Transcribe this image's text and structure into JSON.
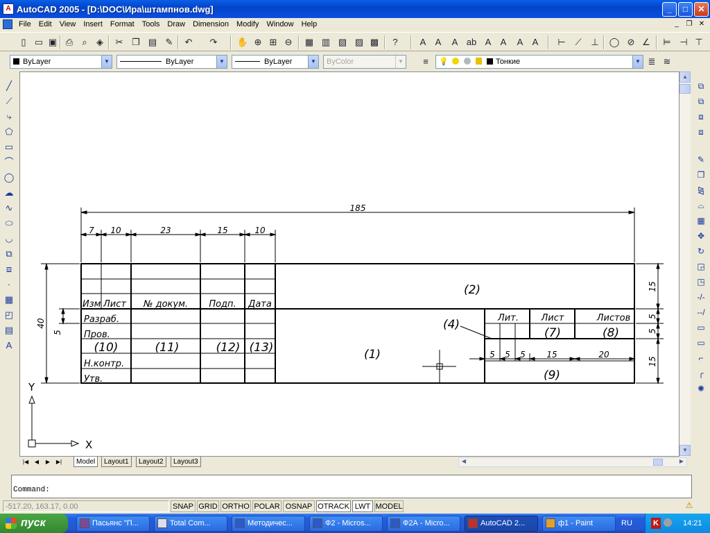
{
  "window": {
    "title": "AutoCAD 2005 - [D:\\DOC\\Ира\\штампнов.dwg]",
    "minimize": "_",
    "maximize": "□",
    "close": "✕"
  },
  "menu": {
    "items": [
      "File",
      "Edit",
      "View",
      "Insert",
      "Format",
      "Tools",
      "Draw",
      "Dimension",
      "Modify",
      "Window",
      "Help"
    ],
    "mdi_min": "_",
    "mdi_restore": "❐",
    "mdi_close": "✕"
  },
  "props": {
    "color": "ByLayer",
    "linetype": "ByLayer",
    "lineweight": "ByLayer",
    "plotstyle": "ByColor",
    "layer": "Тонкие"
  },
  "drawing": {
    "dims": {
      "total": "185",
      "d7": "7",
      "d10": "10",
      "d23": "23",
      "d15": "15",
      "d10b": "10",
      "h40": "40",
      "h5": "5",
      "r15a": "15",
      "r5a": "5",
      "r5b": "5",
      "r15b": "15",
      "s5a": "5",
      "s5b": "5",
      "s5c": "5",
      "s15": "15",
      "s20": "20"
    },
    "headers": {
      "izm": "Изм",
      "list": "Лист",
      "ndoc": "№ докум.",
      "podp": "Подп.",
      "data": "Дата",
      "lit": "Лит.",
      "list2": "Лист",
      "listov": "Листов"
    },
    "rows": {
      "razrab": "Разраб.",
      "prov": "Пров.",
      "nkontr": "Н.контр.",
      "utv": "Утв."
    },
    "fields": {
      "f1": "(1)",
      "f2": "(2)",
      "f4": "(4)",
      "f7": "(7)",
      "f8": "(8)",
      "f9": "(9)",
      "f10": "(10)",
      "f11": "(11)",
      "f12": "(12)",
      "f13": "(13)"
    },
    "ucs": {
      "x": "X",
      "y": "Y"
    }
  },
  "tabs": {
    "model": "Model",
    "layout1": "Layout1",
    "layout2": "Layout2",
    "layout3": "Layout3"
  },
  "command": {
    "prompt": "Command:"
  },
  "status": {
    "coords": "-517.20, 163.17, 0.00",
    "buttons": [
      "SNAP",
      "GRID",
      "ORTHO",
      "POLAR",
      "OSNAP",
      "OTRACK",
      "LWT",
      "MODEL"
    ]
  },
  "taskbar": {
    "start": "пуск",
    "tasks": [
      "Пасьянс \"П...",
      "Total Com...",
      "Методичес...",
      "Ф2 - Micros...",
      "Ф2А - Micro...",
      "AutoCAD 2...",
      "ф1 - Paint"
    ],
    "lang": "RU",
    "clock": "14:21"
  },
  "colors": {
    "title_bar": "#0a4ee0",
    "taskbar": "#245edb",
    "start": "#34872f",
    "drawing_bg": "#ffffff"
  }
}
